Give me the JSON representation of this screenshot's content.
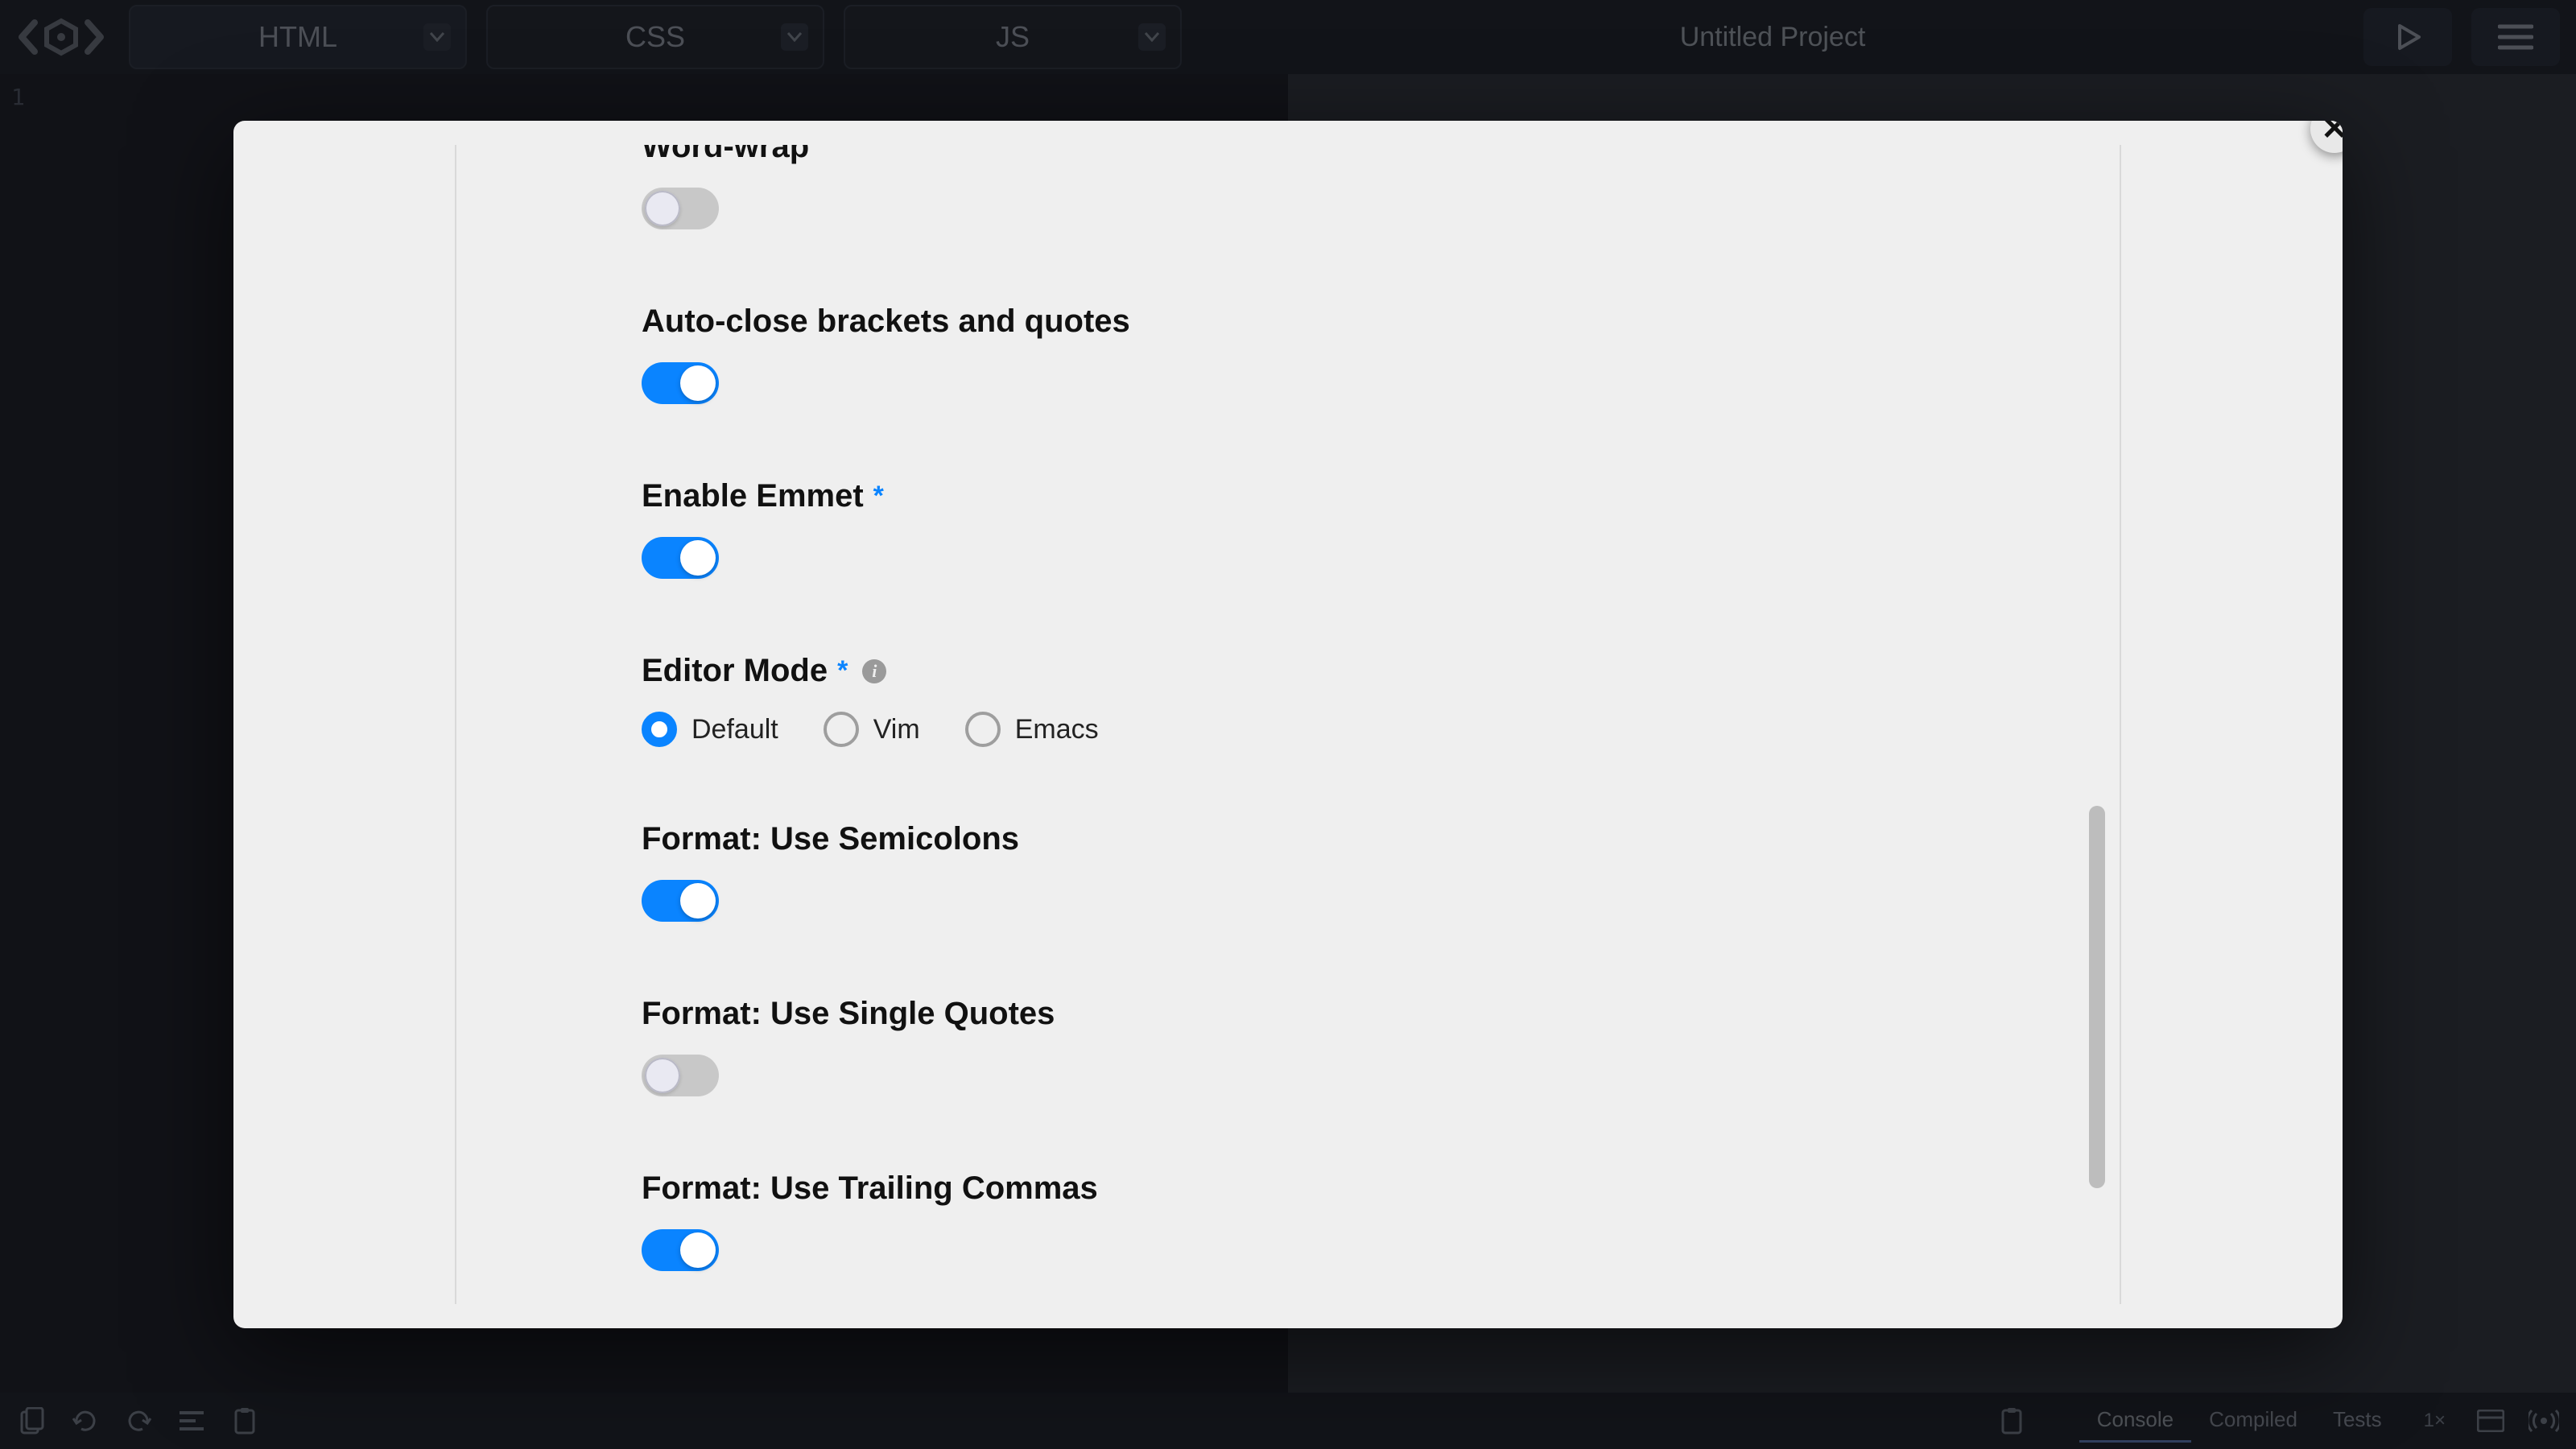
{
  "header": {
    "tabs": {
      "html": "HTML",
      "css": "CSS",
      "js": "JS"
    },
    "project_title": "Untitled Project"
  },
  "editor": {
    "line_number": "1"
  },
  "status": {
    "console": "Console",
    "compiled": "Compiled",
    "tests": "Tests",
    "multiplier": "1×"
  },
  "settings": {
    "word_wrap": {
      "label": "Word-wrap",
      "value": false
    },
    "auto_close": {
      "label": "Auto-close brackets and quotes",
      "value": true
    },
    "emmet": {
      "label": "Enable Emmet",
      "required": true,
      "value": true
    },
    "editor_mode": {
      "label": "Editor Mode",
      "required": true,
      "options": [
        "Default",
        "Vim",
        "Emacs"
      ],
      "selected": "Default"
    },
    "semicolons": {
      "label": "Format: Use Semicolons",
      "value": true
    },
    "single_quotes": {
      "label": "Format: Use Single Quotes",
      "value": false
    },
    "trailing_commas": {
      "label": "Format: Use Trailing Commas",
      "value": true
    }
  },
  "scrollbar": {
    "top_pct": 57,
    "height_pct": 33
  }
}
